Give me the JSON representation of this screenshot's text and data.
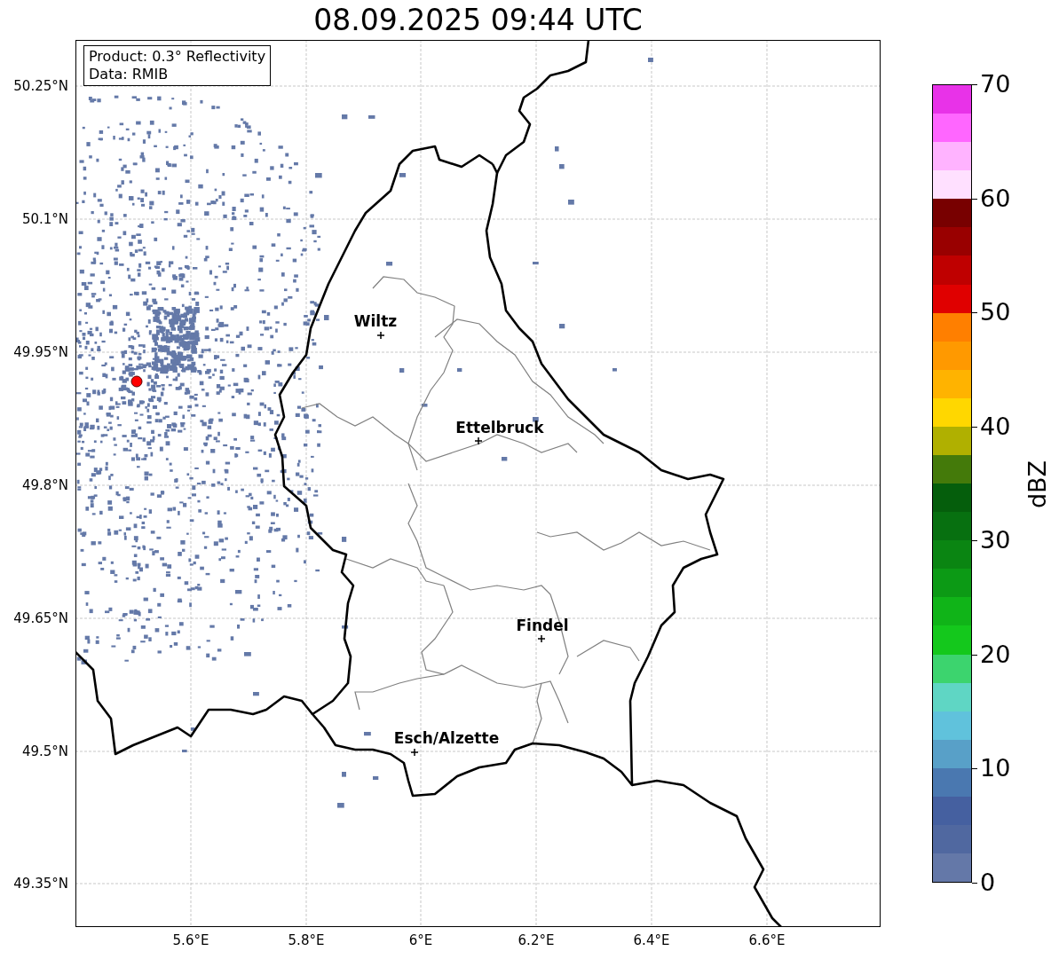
{
  "title": "08.09.2025 09:44 UTC",
  "info_box": [
    "Product: 0.3° Reflectivity",
    "Data: RMIB"
  ],
  "map": {
    "lat_ticks": [
      "50.25°N",
      "50.1°N",
      "49.95°N",
      "49.8°N",
      "49.65°N",
      "49.5°N",
      "49.35°N"
    ],
    "lon_ticks": [
      "5.6°E",
      "5.8°E",
      "6°E",
      "6.2°E",
      "6.4°E",
      "6.6°E"
    ],
    "places": [
      {
        "name": "Wiltz"
      },
      {
        "name": "Ettelbruck"
      },
      {
        "name": "Findel"
      },
      {
        "name": "Esch/Alzette"
      }
    ]
  },
  "colorbar": {
    "label": "dBZ",
    "ticks": [
      "70",
      "60",
      "50",
      "40",
      "30",
      "20",
      "10",
      "0"
    ],
    "bins": [
      {
        "color": "#e832e8"
      },
      {
        "color": "#ff66ff"
      },
      {
        "color": "#ffb3ff"
      },
      {
        "color": "#ffe0ff"
      },
      {
        "color": "#780000"
      },
      {
        "color": "#990000"
      },
      {
        "color": "#bf0000"
      },
      {
        "color": "#e00000"
      },
      {
        "color": "#ff7f00"
      },
      {
        "color": "#ff9900"
      },
      {
        "color": "#ffb300"
      },
      {
        "color": "#ffd700"
      },
      {
        "color": "#b0b000"
      },
      {
        "color": "#447a0a"
      },
      {
        "color": "#055e0c"
      },
      {
        "color": "#077010"
      },
      {
        "color": "#0a8512"
      },
      {
        "color": "#0c9a15"
      },
      {
        "color": "#10b418"
      },
      {
        "color": "#14c81c"
      },
      {
        "color": "#3cd46e"
      },
      {
        "color": "#5fd6c4"
      },
      {
        "color": "#60c2dc"
      },
      {
        "color": "#58a0c8"
      },
      {
        "color": "#4a78b0"
      },
      {
        "color": "#4560a0"
      },
      {
        "color": "#5068a0"
      },
      {
        "color": "#6478a8"
      }
    ]
  }
}
